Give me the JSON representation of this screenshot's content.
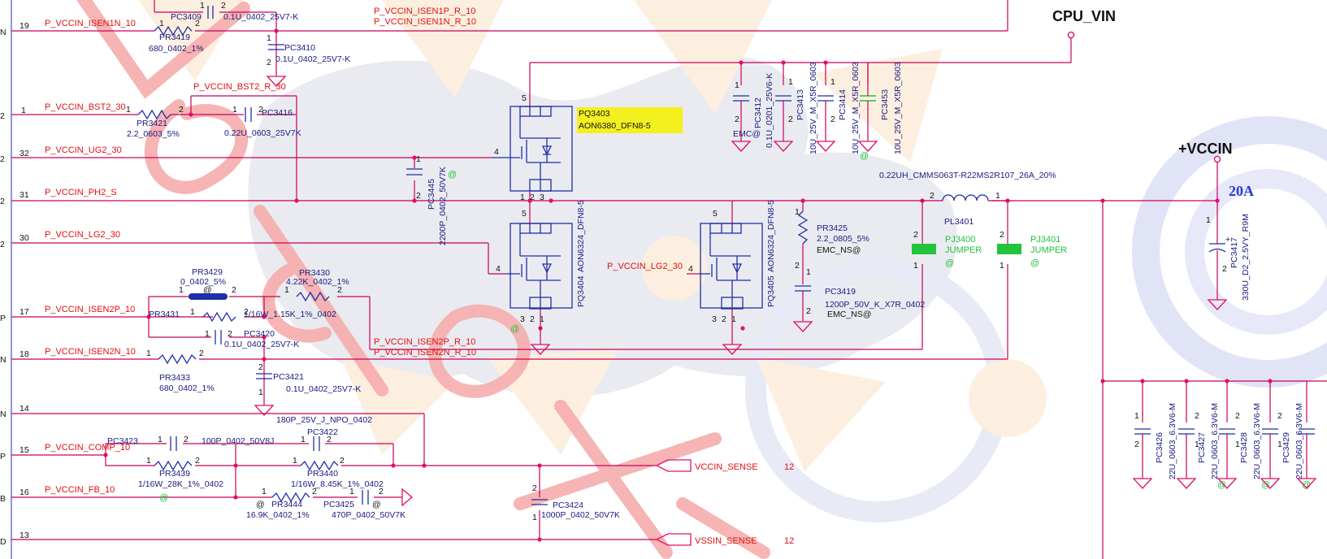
{
  "rails": {
    "cpu_vin": "CPU_VIN",
    "vccin": "+VCCIN",
    "current": "20A"
  },
  "nets": {
    "isen1n": "P_VCCIN_ISEN1N_10",
    "bst2": "P_VCCIN_BST2_30",
    "bst2r": "P_VCCIN_BST2_R_30",
    "ug2": "P_VCCIN_UG2_30",
    "ph2": "P_VCCIN_PH2_S",
    "lg2": "P_VCCIN_LG2_30",
    "lg2b": "P_VCCIN_LG2_30",
    "isen2p": "P_VCCIN_ISEN2P_10",
    "isen2n": "P_VCCIN_ISEN2N_10",
    "comp": "P_VCCIN_COMP_10",
    "fb": "P_VCCIN_FB_10",
    "isen1p_r": "P_VCCIN_ISEN1P_R_10",
    "isen1n_r": "P_VCCIN_ISEN1N_R_10",
    "isen2p_r": "P_VCCIN_ISEN2P_R_10",
    "isen2n_r": "P_VCCIN_ISEN2N_R_10",
    "vccin_sense": "VCCIN_SENSE",
    "vssin_sense": "VSSIN_SENSE",
    "sheet12a": "12",
    "sheet12b": "12"
  },
  "edge_letters": [
    "N",
    "2",
    "2",
    "2",
    "2",
    "P",
    "N",
    "N",
    "P",
    "B",
    "D"
  ],
  "left_pins": [
    "19",
    "1",
    "32",
    "31",
    "30",
    "17",
    "18",
    "14",
    "15",
    "16",
    "13"
  ],
  "parts": {
    "pc3409": {
      "ref": "PC3409",
      "val": "0.1U_0402_25V7-K"
    },
    "pr3419": {
      "ref": "PR3419",
      "val": "680_0402_1%"
    },
    "pc3410": {
      "ref": "PC3410",
      "val": "0.1U_0402_25V7-K"
    },
    "pr3421": {
      "ref": "PR3421",
      "val": "2.2_0603_5%"
    },
    "pc3416": {
      "ref": "PC3416",
      "val": "0.22U_0603_25V7K"
    },
    "pc3445": {
      "ref": "PC3445",
      "val": "2200P_0402_50V7K"
    },
    "pq3403": {
      "ref": "PQ3403",
      "val": "AON6380_DFN8-5"
    },
    "pq3404": {
      "ref": "PQ3404",
      "val": "AON6324_DFN8-5"
    },
    "pq3405": {
      "ref": "PQ3405",
      "val": "AON6324_DFN8-5"
    },
    "pc3412": {
      "ref": "PC3412",
      "val": "0.1U_0201_25V6-K"
    },
    "pc3413": {
      "ref": "PC3413",
      "val": "10U_25V_M_X5R_0603"
    },
    "pc3414": {
      "ref": "PC3414",
      "val": "10U_25V_M_X5R_0603"
    },
    "pc3453": {
      "ref": "PC3453",
      "val": "10U_25V_M_X5R_0603"
    },
    "emc": "EMC@",
    "pl3401": {
      "ref": "PL3401",
      "val": "0.22UH_CMMS063T-R22MS2R107_26A_20%"
    },
    "pr3425": {
      "ref": "PR3425",
      "val": "2.2_0805_5%",
      "opt": "EMC_NS@"
    },
    "pc3419": {
      "ref": "PC3419",
      "val": "1200P_50V_K_X7R_0402",
      "opt": "EMC_NS@"
    },
    "pj3400": {
      "ref": "PJ3400",
      "val": "JUMPER"
    },
    "pj3401": {
      "ref": "PJ3401",
      "val": "JUMPER"
    },
    "pc3417": {
      "ref": "PC3417",
      "val": "330U_D2_2.5VY_R9M"
    },
    "pr3429": {
      "ref": "PR3429",
      "val": "0_0402_5%"
    },
    "pr3430": {
      "ref": "PR3430",
      "val": "4.22K_0402_1%"
    },
    "pr3431": {
      "ref": "PR3431",
      "val": "1/16W_1.15K_1%_0402"
    },
    "pc3420": {
      "ref": "PC3420",
      "val": "0.1U_0402_25V7-K"
    },
    "pr3433": {
      "ref": "PR3433",
      "val": "680_0402_1%"
    },
    "pc3421": {
      "ref": "PC3421",
      "val": "0.1U_0402_25V7-K"
    },
    "c180p": "180P_25V_J_NPO_0402",
    "pc3423": {
      "ref": "PC3423",
      "val": "100P_0402_50V8J"
    },
    "pc3422": {
      "ref": "PC3422"
    },
    "pr3439": {
      "ref": "PR3439",
      "val": "1/16W_28K_1%_0402"
    },
    "pr3440": {
      "ref": "PR3440",
      "val": "1/16W_8.45K_1%_0402"
    },
    "pr3444": {
      "ref": "PR3444",
      "val": "16.9K_0402_1%"
    },
    "pc3425": {
      "ref": "PC3425",
      "val": "470P_0402_50V7K"
    },
    "pc3424": {
      "ref": "PC3424",
      "val": "1000P_0402_50V7K"
    },
    "pc3426": {
      "ref": "PC3426",
      "val": "22U_0603_6.3V6-M"
    },
    "pc3427": {
      "ref": "PC3427",
      "val": "22U_0603_6.3V6-M"
    },
    "pc3428": {
      "ref": "PC3428",
      "val": "22U_0603_6.3V6-M"
    },
    "pc3429": {
      "ref": "PC3429",
      "val": "22U_0603_6.3V6-M"
    }
  },
  "at": "@",
  "colors": {
    "wire": "#c8005a",
    "part": "#1f2fa8",
    "net": "#e01010",
    "highlight": "#f4f020",
    "jumper": "#22c43a"
  }
}
